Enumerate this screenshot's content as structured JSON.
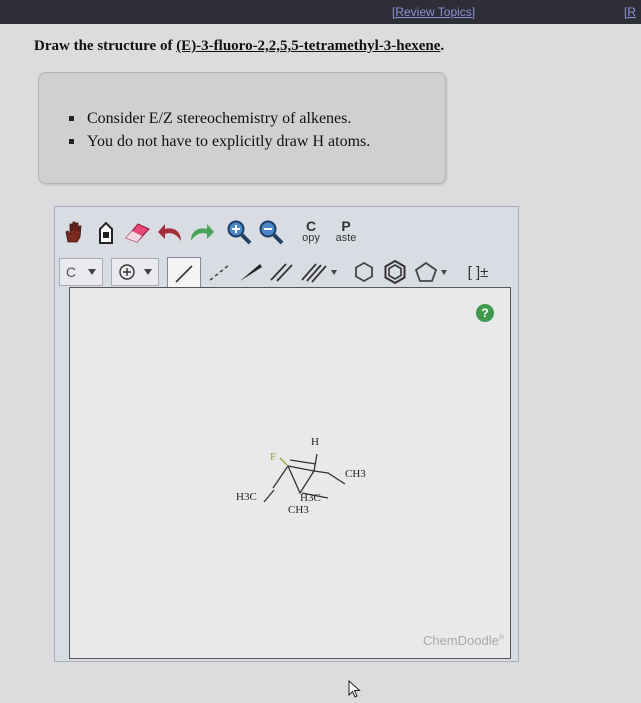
{
  "header": {
    "review_topics": "[Review Topics]",
    "review_topics_2": "[R"
  },
  "question": {
    "prefix": "Draw the structure of ",
    "name": "(E)-3-fluoro-2,2,5,5-tetramethyl-3-hexene",
    "suffix": "."
  },
  "hints": [
    "Consider E/Z stereochemistry of alkenes.",
    "You do not have to explicitly draw H atoms."
  ],
  "toolbar": {
    "copy_letter": "C",
    "copy_label": "opy",
    "paste_letter": "P",
    "paste_label": "aste",
    "element_value": "C",
    "bracket_label": "[ ]±"
  },
  "canvas": {
    "help": "?",
    "brand": "ChemDoodle",
    "brand_mark": "®",
    "atoms": {
      "h": "H",
      "f": "F",
      "ch3_right": "CH3",
      "h3c_left": "H3C",
      "h3c_lower": "H3C",
      "ch3_lower": "CH3"
    }
  },
  "icons": [
    "hand-icon",
    "eraser-tool-icon",
    "eraser-icon",
    "undo-icon",
    "redo-icon",
    "zoom-in-icon",
    "zoom-out-icon",
    "charge-icon",
    "single-bond-icon",
    "wedge-bond-icon",
    "double-bond-icon",
    "triple-bond-icon",
    "cyclopropane-icon",
    "benzene-icon",
    "cyclopentane-icon",
    "help-icon",
    "mouse-cursor-icon"
  ]
}
